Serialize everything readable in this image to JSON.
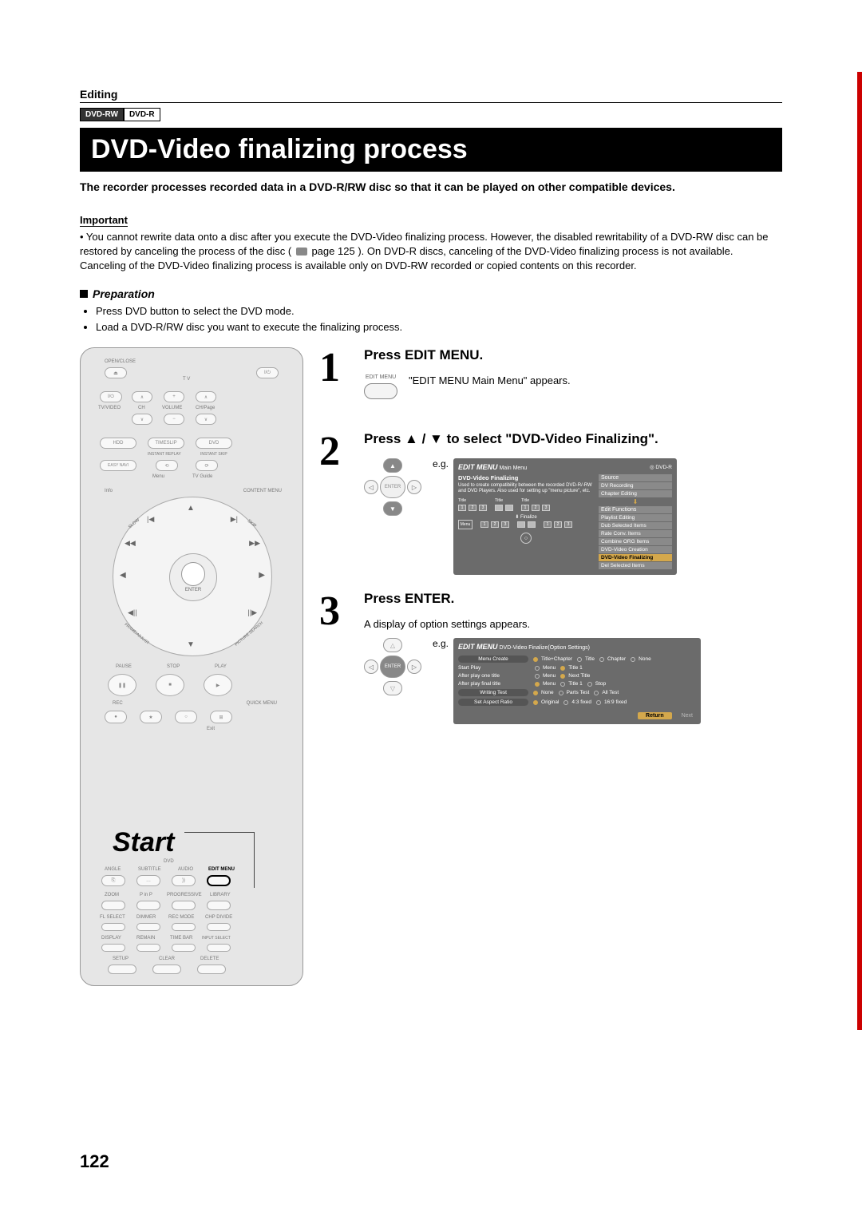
{
  "header": {
    "editing_label": "Editing",
    "badge_dvd_rw": "DVD-RW",
    "badge_dvd_r": "DVD-R"
  },
  "title": "DVD-Video finalizing process",
  "intro": "The recorder processes recorded data in a DVD-R/RW disc so that it can be played on other compatible devices.",
  "important": {
    "label": "Important",
    "text1": "• You cannot rewrite data onto a disc after you execute the DVD-Video finalizing process. However, the disabled rewritability of a DVD-RW disc can be restored by canceling the process of the disc (",
    "page_ref": "page 125",
    "text2": "). On DVD-R discs, canceling of the DVD-Video finalizing process is not available.",
    "text3": "Canceling of the DVD-Video finalizing process is available only on DVD-RW recorded or copied contents on this recorder."
  },
  "preparation": {
    "label": "Preparation",
    "items": [
      "Press DVD button to select the DVD mode.",
      "Load a DVD-R/RW disc you want to execute the finalizing process."
    ]
  },
  "remote": {
    "start_label": "Start",
    "labels": {
      "open_close": "OPEN/CLOSE",
      "tv": "T V",
      "tv_video": "TV/VIDEO",
      "ch": "CH",
      "volume": "VOLUME",
      "ch_page": "CH/Page",
      "hdd": "HDD",
      "timeslip": "TIMESLIP",
      "dvd": "DVD",
      "instant_replay": "INSTANT REPLAY",
      "instant_skip": "INSTANT SKIP",
      "easy_navi": "EASY NAVI",
      "menu": "Menu",
      "tv_guide": "TV Guide",
      "info": "Info",
      "content_menu": "CONTENT MENU",
      "enter": "ENTER",
      "slow": "SLOW",
      "skip": "SKIP",
      "frame_adjust": "FRAME/ADJUST",
      "picture_search": "PICTURE SEARCH",
      "pause": "PAUSE",
      "stop": "STOP",
      "play": "PLAY",
      "rec": "REC",
      "quick_menu": "QUICK MENU",
      "exit": "Exit",
      "angle": "ANGLE",
      "subtitle": "SUBTITLE",
      "audio": "AUDIO",
      "edit_menu": "EDIT MENU",
      "zoom": "ZOOM",
      "p_in_p": "P in P",
      "progressive": "PROGRESSIVE",
      "library": "LIBRARY",
      "fl_select": "FL SELECT",
      "dimmer": "DIMMER",
      "rec_mode": "REC MODE",
      "chp_divide": "CHP DIVIDE",
      "display": "DISPLAY",
      "remain": "REMAIN",
      "time_bar": "TIME BAR",
      "input_select": "INPUT SELECT",
      "setup": "SETUP",
      "clear": "CLEAR",
      "delete": "DELETE",
      "dvd_label": "DVD"
    }
  },
  "steps": {
    "s1": {
      "num": "1",
      "title": "Press EDIT MENU.",
      "desc": "\"EDIT MENU Main Menu\" appears.",
      "icon_label": "EDIT MENU"
    },
    "s2": {
      "num": "2",
      "title": "Press ▲ / ▼ to select \"DVD-Video Finalizing\".",
      "eg_label": "e.g.",
      "enter": "ENTER"
    },
    "s3": {
      "num": "3",
      "title": "Press ENTER.",
      "desc": "A display of option settings appears.",
      "eg_label": "e.g.",
      "enter": "ENTER"
    }
  },
  "osd1": {
    "logo": "EDIT MENU",
    "main_menu": "Main Menu",
    "disc_badge": "DVD-R",
    "left_title": "DVD-Video Finalizing",
    "left_desc": "Used to create compatibility between the recorded DVD-R/-RW and DVD Players. Also used for setting up \"menu picture\", etc.",
    "thumb_title": "Title",
    "finalize_label": "Finalize",
    "menu_label": "Menu",
    "right_section1": "Source",
    "right_items1": [
      "DV Recording",
      "Chapter Editing"
    ],
    "right_section2": "Edit Functions",
    "right_items2": [
      "Playlist Editing",
      "Dub Selected Items",
      "Rate Conv. Items",
      "Combine ORG Items",
      "DVD-Video Creation"
    ],
    "right_hl": "DVD-Video Finalizing",
    "right_last": "Del Selected Items"
  },
  "osd2": {
    "logo": "EDIT MENU",
    "subtitle": "DVD-Video Finalize(Option Settings)",
    "rows": [
      {
        "pill": true,
        "label": "  Menu Create  ",
        "opts": [
          "Title+Chapter",
          "Title",
          "Chapter",
          "None"
        ],
        "sel": 0
      },
      {
        "pill": false,
        "label": "Start Play",
        "opts": [
          "Menu",
          "Title 1"
        ],
        "sel": 1
      },
      {
        "pill": false,
        "label": "After play one title",
        "opts": [
          "Menu",
          "Next Title"
        ],
        "sel": 1
      },
      {
        "pill": false,
        "label": "After play final title",
        "opts": [
          "Menu",
          "Title 1",
          "Stop"
        ],
        "sel": 0
      },
      {
        "pill": true,
        "label": "  Writing Test  ",
        "opts": [
          "None",
          "Parts Test",
          "All Test"
        ],
        "sel": 0
      },
      {
        "pill": true,
        "label": "Set Aspect Ratio",
        "opts": [
          "Original",
          "4:3 fixed",
          "16:9 fixed"
        ],
        "sel": 0
      }
    ],
    "return": "Return",
    "next": "Next"
  },
  "page_number": "122"
}
